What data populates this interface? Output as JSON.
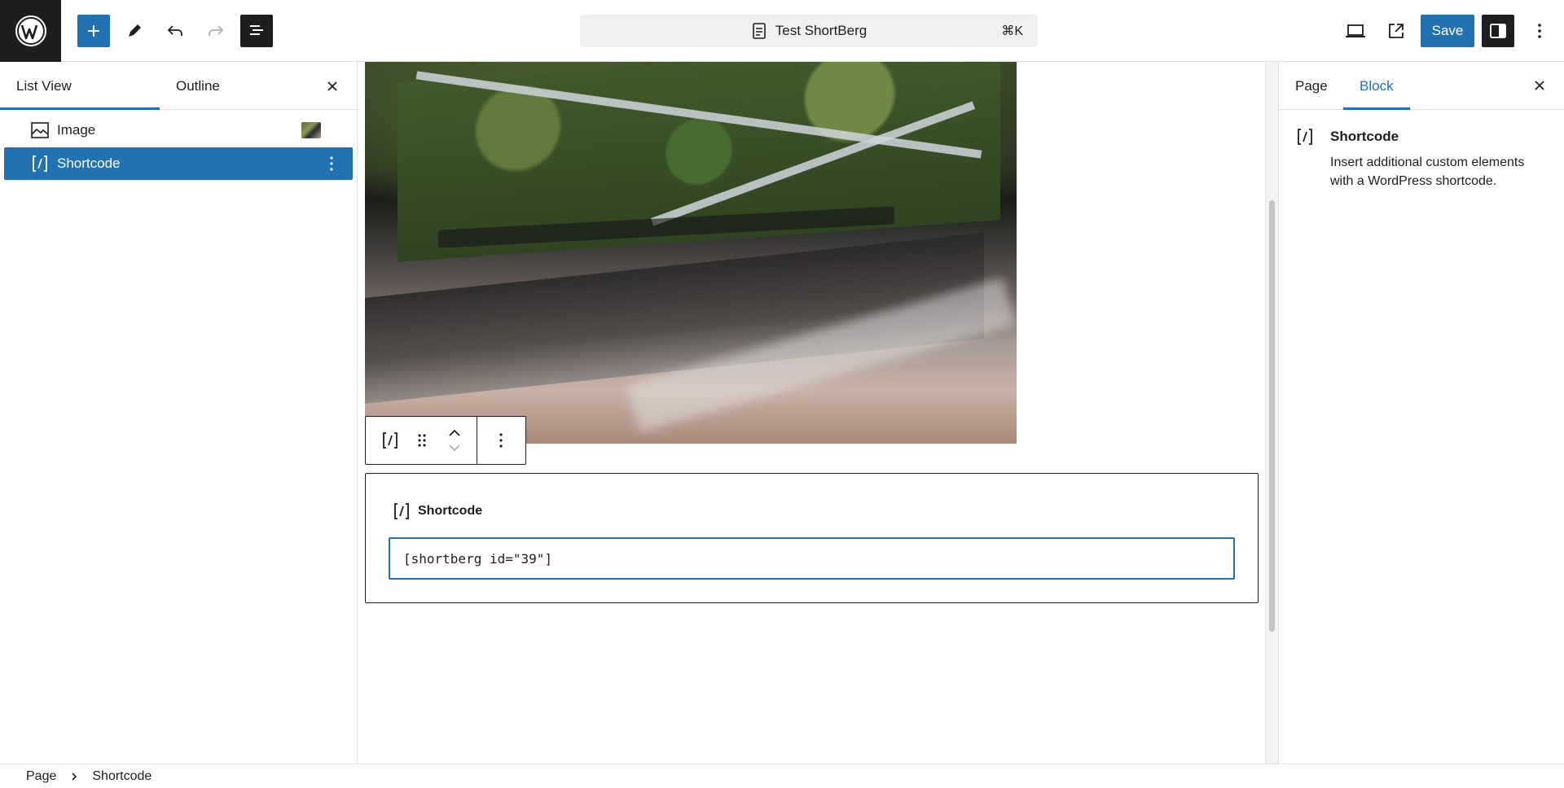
{
  "toolbar": {
    "document_title": "Test ShortBerg",
    "command_shortcut": "⌘K",
    "save_label": "Save"
  },
  "list_view": {
    "tabs": [
      {
        "label": "List View",
        "active": true
      },
      {
        "label": "Outline",
        "active": false
      }
    ],
    "items": [
      {
        "label": "Image",
        "icon": "image-icon",
        "selected": false
      },
      {
        "label": "Shortcode",
        "icon": "shortcode-icon",
        "selected": true
      }
    ]
  },
  "canvas": {
    "shortcode_block": {
      "title": "Shortcode",
      "value": "[shortberg id=\"39\"]"
    }
  },
  "sidebar": {
    "tabs": [
      {
        "label": "Page",
        "active": false
      },
      {
        "label": "Block",
        "active": true
      }
    ],
    "block_card": {
      "title": "Shortcode",
      "description": "Insert additional custom elements with a WordPress shortcode."
    }
  },
  "breadcrumb": {
    "items": [
      "Page",
      "Shortcode"
    ]
  },
  "colors": {
    "accent": "#2271b1",
    "dark": "#1e1e1e"
  }
}
